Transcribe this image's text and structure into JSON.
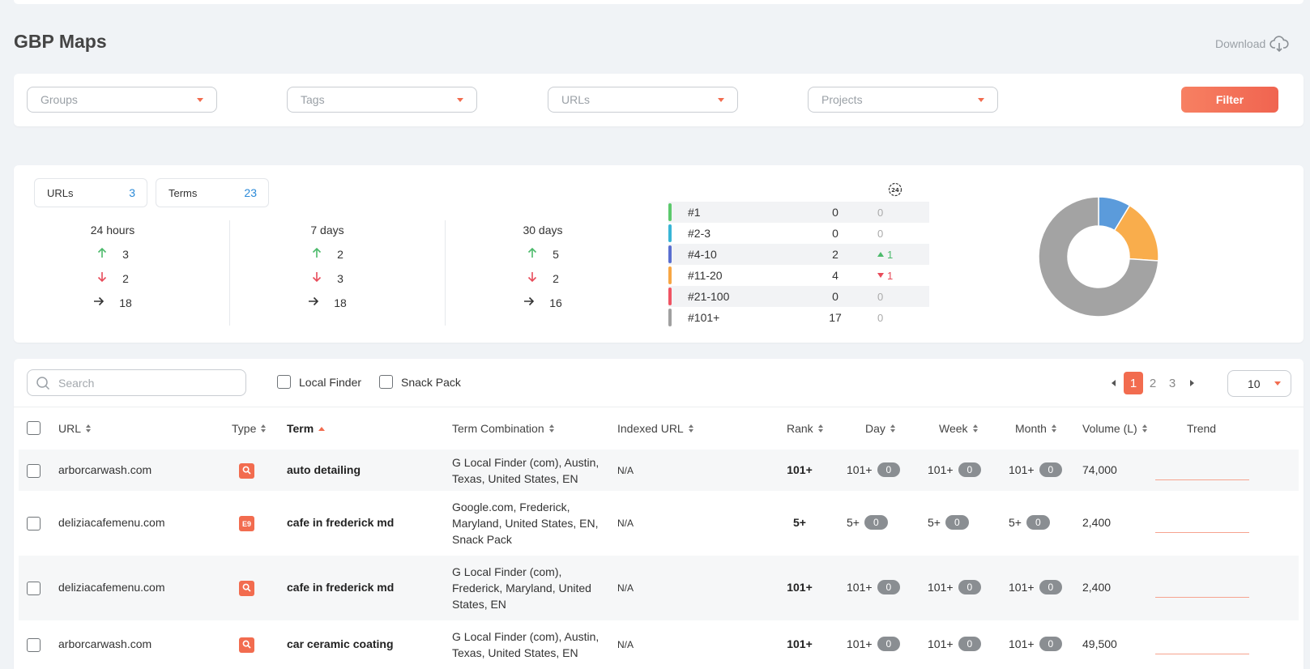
{
  "page": {
    "title": "GBP Maps",
    "download_label": "Download"
  },
  "filters": {
    "groups_placeholder": "Groups",
    "tags_placeholder": "Tags",
    "urls_placeholder": "URLs",
    "projects_placeholder": "Projects",
    "filter_label": "Filter"
  },
  "summary": {
    "urls_label": "URLs",
    "urls_count": "3",
    "terms_label": "Terms",
    "terms_count": "23",
    "periods": [
      {
        "title": "24 hours",
        "up": "3",
        "down": "2",
        "flat": "18"
      },
      {
        "title": "7 days",
        "up": "2",
        "down": "3",
        "flat": "18"
      },
      {
        "title": "30 days",
        "up": "5",
        "down": "2",
        "flat": "16"
      }
    ],
    "reset_icon_label": "24",
    "ranks": [
      {
        "label": "#1",
        "count": "0",
        "change": "0",
        "dir": "none",
        "color": "#5cc96c"
      },
      {
        "label": "#2-3",
        "count": "0",
        "change": "0",
        "dir": "none",
        "color": "#38b5d6"
      },
      {
        "label": "#4-10",
        "count": "2",
        "change": "1",
        "dir": "up",
        "color": "#5a6fd0"
      },
      {
        "label": "#11-20",
        "count": "4",
        "change": "1",
        "dir": "down",
        "color": "#f7a644"
      },
      {
        "label": "#21-100",
        "count": "0",
        "change": "0",
        "dir": "none",
        "color": "#ef5463"
      },
      {
        "label": "#101+",
        "count": "17",
        "change": "0",
        "dir": "none",
        "color": "#a0a0a0"
      }
    ]
  },
  "chart_data": {
    "type": "pie",
    "categories": [
      "#4-10",
      "#11-20",
      "#101+"
    ],
    "values": [
      2,
      4,
      17
    ],
    "colors": [
      "#5b9bdb",
      "#f9ad4c",
      "#a3a3a3"
    ],
    "donut": true
  },
  "toolbar": {
    "search_placeholder": "Search",
    "local_finder_label": "Local Finder",
    "snack_pack_label": "Snack Pack",
    "pages": [
      "1",
      "2",
      "3"
    ],
    "active_page": "1",
    "per_page": "10"
  },
  "table": {
    "headers": {
      "url": "URL",
      "type": "Type",
      "term": "Term",
      "combination": "Term Combination",
      "indexed": "Indexed URL",
      "rank": "Rank",
      "day": "Day",
      "week": "Week",
      "month": "Month",
      "volume": "Volume (L)",
      "trend": "Trend"
    },
    "rows": [
      {
        "url": "arborcarwash.com",
        "type": "local-finder",
        "term": "auto detailing",
        "combination": "G Local Finder (com), Austin, Texas, United States, EN",
        "indexed": "N/A",
        "rank": "101+",
        "day": "101+",
        "day_change": "0",
        "week": "101+",
        "week_change": "0",
        "month": "101+",
        "month_change": "0",
        "volume": "74,000"
      },
      {
        "url": "deliziacafemenu.com",
        "type": "snack-pack",
        "type_label": "E9",
        "term": "cafe in frederick md",
        "combination": "Google.com, Frederick, Maryland, United States, EN, Snack Pack",
        "indexed": "N/A",
        "rank": "5+",
        "day": "5+",
        "day_change": "0",
        "week": "5+",
        "week_change": "0",
        "month": "5+",
        "month_change": "0",
        "volume": "2,400"
      },
      {
        "url": "deliziacafemenu.com",
        "type": "local-finder",
        "term": "cafe in frederick md",
        "combination": "G Local Finder (com), Frederick, Maryland, United States, EN",
        "indexed": "N/A",
        "rank": "101+",
        "day": "101+",
        "day_change": "0",
        "week": "101+",
        "week_change": "0",
        "month": "101+",
        "month_change": "0",
        "volume": "2,400"
      },
      {
        "url": "arborcarwash.com",
        "type": "local-finder",
        "term": "car ceramic coating",
        "combination": "G Local Finder (com), Austin, Texas, United States, EN",
        "indexed": "N/A",
        "rank": "101+",
        "day": "101+",
        "day_change": "0",
        "week": "101+",
        "week_change": "0",
        "month": "101+",
        "month_change": "0",
        "volume": "49,500"
      }
    ]
  }
}
